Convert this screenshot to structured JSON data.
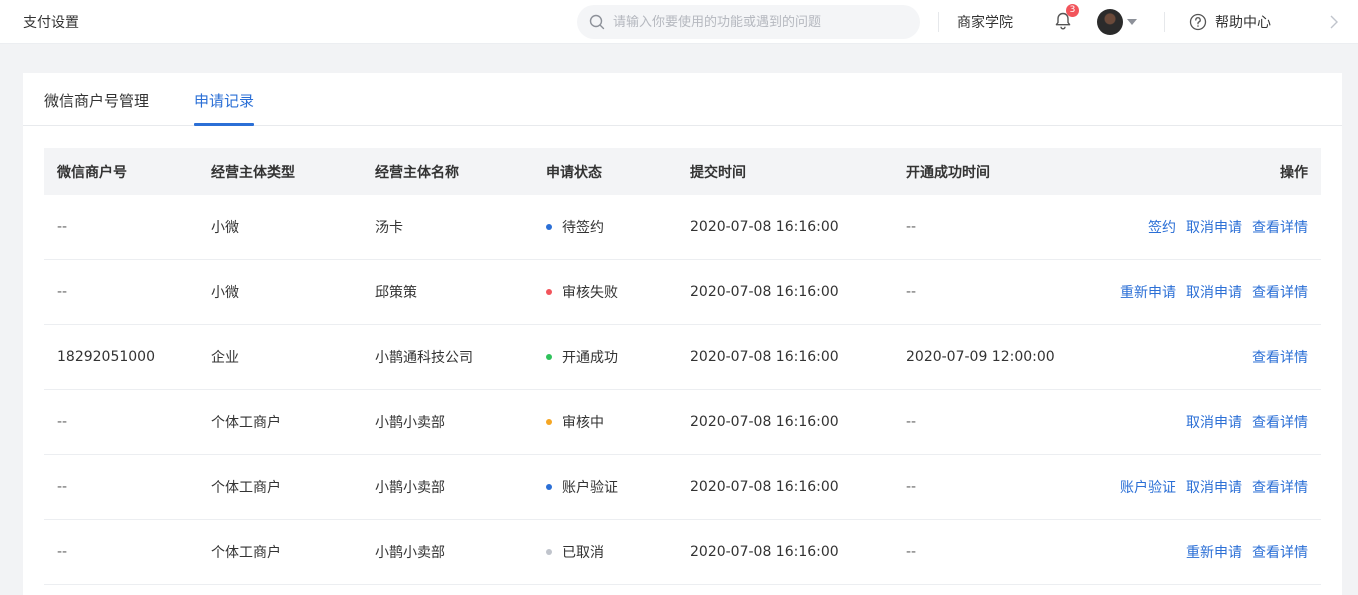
{
  "header": {
    "title": "支付设置",
    "search_placeholder": "请输入你要使用的功能或遇到的问题",
    "academy": "商家学院",
    "notification_count": "3",
    "help": "帮助中心"
  },
  "tabs": [
    {
      "label": "微信商户号管理",
      "active": false
    },
    {
      "label": "申请记录",
      "active": true
    }
  ],
  "table": {
    "columns": [
      "微信商户号",
      "经营主体类型",
      "经营主体名称",
      "申请状态",
      "提交时间",
      "开通成功时间",
      "操作"
    ],
    "rows": [
      {
        "merchant_id": "--",
        "type": "小微",
        "name": "汤卡",
        "status": "待签约",
        "status_color": "#2b6fd6",
        "submitted": "2020-07-08 16:16:00",
        "opened": "--",
        "actions": [
          "签约",
          "取消申请",
          "查看详情"
        ]
      },
      {
        "merchant_id": "--",
        "type": "小微",
        "name": "邱策策",
        "status": "审核失败",
        "status_color": "#f2545b",
        "submitted": "2020-07-08 16:16:00",
        "opened": "--",
        "actions": [
          "重新申请",
          "取消申请",
          "查看详情"
        ]
      },
      {
        "merchant_id": "18292051000",
        "type": "企业",
        "name": "小鹊通科技公司",
        "status": "开通成功",
        "status_color": "#2fc25b",
        "submitted": "2020-07-08 16:16:00",
        "opened": "2020-07-09 12:00:00",
        "actions": [
          "查看详情"
        ]
      },
      {
        "merchant_id": "--",
        "type": "个体工商户",
        "name": "小鹊小卖部",
        "status": "审核中",
        "status_color": "#f5a623",
        "submitted": "2020-07-08 16:16:00",
        "opened": "--",
        "actions": [
          "取消申请",
          "查看详情"
        ]
      },
      {
        "merchant_id": "--",
        "type": "个体工商户",
        "name": "小鹊小卖部",
        "status": "账户验证",
        "status_color": "#2b6fd6",
        "submitted": "2020-07-08 16:16:00",
        "opened": "--",
        "actions": [
          "账户验证",
          "取消申请",
          "查看详情"
        ]
      },
      {
        "merchant_id": "--",
        "type": "个体工商户",
        "name": "小鹊小卖部",
        "status": "已取消",
        "status_color": "#c0c4cc",
        "submitted": "2020-07-08 16:16:00",
        "opened": "--",
        "actions": [
          "重新申请",
          "查看详情"
        ]
      }
    ]
  }
}
